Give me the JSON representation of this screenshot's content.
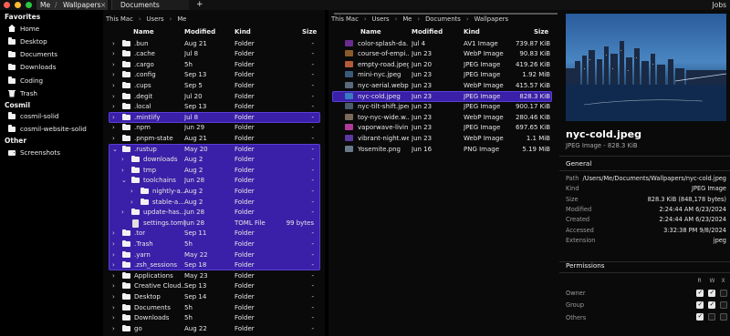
{
  "tabs": {
    "crumb_root": "Me",
    "crumb_sep": "/",
    "active_tab": "Wallpapers",
    "close_glyph": "×",
    "second_tab": "Documents",
    "add_glyph": "+",
    "user": "Jobs"
  },
  "sidebar": {
    "favorites_heading": "Favorites",
    "favorites": [
      {
        "label": "Home",
        "icon": "home-icon"
      },
      {
        "label": "Desktop",
        "icon": "folder-icon"
      },
      {
        "label": "Documents",
        "icon": "folder-icon"
      },
      {
        "label": "Downloads",
        "icon": "folder-icon"
      },
      {
        "label": "Coding",
        "icon": "folder-icon"
      },
      {
        "label": "Trash",
        "icon": "trash-icon"
      }
    ],
    "cosmil_heading": "Cosmil",
    "cosmil": [
      {
        "label": "cosmil-solid",
        "icon": "folder-icon"
      },
      {
        "label": "cosmil-website-solid",
        "icon": "folder-icon"
      }
    ],
    "other_heading": "Other",
    "other": [
      {
        "label": "Screenshots",
        "icon": "drive-icon"
      }
    ]
  },
  "column1": {
    "breadcrumb": [
      "This Mac",
      "Users",
      "Me"
    ],
    "headers": {
      "name": "Name",
      "modified": "Modified",
      "kind": "Kind",
      "size": "Size"
    },
    "rows": [
      {
        "name": ".bun",
        "modified": "Aug 21",
        "kind": "Folder",
        "size": "-",
        "depth": 0,
        "open": false,
        "state": ""
      },
      {
        "name": ".cache",
        "modified": "Jul 8",
        "kind": "Folder",
        "size": "-",
        "depth": 0,
        "open": false,
        "state": ""
      },
      {
        "name": ".cargo",
        "modified": "5h",
        "kind": "Folder",
        "size": "-",
        "depth": 0,
        "open": false,
        "state": ""
      },
      {
        "name": ".config",
        "modified": "Sep 13",
        "kind": "Folder",
        "size": "-",
        "depth": 0,
        "open": false,
        "state": ""
      },
      {
        "name": ".cups",
        "modified": "Sep 5",
        "kind": "Folder",
        "size": "-",
        "depth": 0,
        "open": false,
        "state": ""
      },
      {
        "name": ".degit",
        "modified": "Jul 20",
        "kind": "Folder",
        "size": "-",
        "depth": 0,
        "open": false,
        "state": ""
      },
      {
        "name": ".local",
        "modified": "Sep 13",
        "kind": "Folder",
        "size": "-",
        "depth": 0,
        "open": false,
        "state": ""
      },
      {
        "name": ".mintlify",
        "modified": "Jul 8",
        "kind": "Folder",
        "size": "-",
        "depth": 0,
        "open": false,
        "state": "selected"
      },
      {
        "name": ".npm",
        "modified": "Jun 29",
        "kind": "Folder",
        "size": "-",
        "depth": 0,
        "open": false,
        "state": ""
      },
      {
        "name": ".pnpm-state",
        "modified": "Aug 21",
        "kind": "Folder",
        "size": "-",
        "depth": 0,
        "open": false,
        "state": ""
      },
      {
        "name": ".rustup",
        "modified": "May 20",
        "kind": "Folder",
        "size": "-",
        "depth": 0,
        "open": true,
        "state": "group"
      },
      {
        "name": "downloads",
        "modified": "Aug 2",
        "kind": "Folder",
        "size": "-",
        "depth": 1,
        "open": false,
        "state": "group"
      },
      {
        "name": "tmp",
        "modified": "Aug 2",
        "kind": "Folder",
        "size": "-",
        "depth": 1,
        "open": false,
        "state": "group"
      },
      {
        "name": "toolchains",
        "modified": "Jun 28",
        "kind": "Folder",
        "size": "-",
        "depth": 1,
        "open": true,
        "state": "group"
      },
      {
        "name": "nightly-a...",
        "modified": "Aug 2",
        "kind": "Folder",
        "size": "-",
        "depth": 2,
        "open": false,
        "state": "group"
      },
      {
        "name": "stable-a...",
        "modified": "Aug 2",
        "kind": "Folder",
        "size": "-",
        "depth": 2,
        "open": false,
        "state": "group"
      },
      {
        "name": "update-has...",
        "modified": "Jun 28",
        "kind": "Folder",
        "size": "-",
        "depth": 1,
        "open": false,
        "state": "group"
      },
      {
        "name": "settings.toml",
        "modified": "Jun 28",
        "kind": "TOML File",
        "size": "99 bytes",
        "depth": 1,
        "open": false,
        "state": "group",
        "file": true
      },
      {
        "name": ".tor",
        "modified": "Sep 11",
        "kind": "Folder",
        "size": "-",
        "depth": 0,
        "open": false,
        "state": "group"
      },
      {
        "name": ".Trash",
        "modified": "5h",
        "kind": "Folder",
        "size": "-",
        "depth": 0,
        "open": false,
        "state": "group"
      },
      {
        "name": ".yarn",
        "modified": "May 22",
        "kind": "Folder",
        "size": "-",
        "depth": 0,
        "open": false,
        "state": "group"
      },
      {
        "name": ".zsh_sessions",
        "modified": "Sep 18",
        "kind": "Folder",
        "size": "-",
        "depth": 0,
        "open": false,
        "state": "group"
      },
      {
        "name": "Applications",
        "modified": "May 23",
        "kind": "Folder",
        "size": "-",
        "depth": 0,
        "open": false,
        "state": ""
      },
      {
        "name": "Creative Cloud...",
        "modified": "Sep 13",
        "kind": "Folder",
        "size": "-",
        "depth": 0,
        "open": false,
        "state": ""
      },
      {
        "name": "Desktop",
        "modified": "Sep 14",
        "kind": "Folder",
        "size": "-",
        "depth": 0,
        "open": false,
        "state": ""
      },
      {
        "name": "Documents",
        "modified": "5h",
        "kind": "Folder",
        "size": "-",
        "depth": 0,
        "open": false,
        "state": ""
      },
      {
        "name": "Downloads",
        "modified": "5h",
        "kind": "Folder",
        "size": "-",
        "depth": 0,
        "open": false,
        "state": ""
      },
      {
        "name": "go",
        "modified": "Aug 22",
        "kind": "Folder",
        "size": "-",
        "depth": 0,
        "open": false,
        "state": ""
      }
    ]
  },
  "column2": {
    "breadcrumb": [
      "This Mac",
      "Users",
      "Me",
      "Documents",
      "Wallpapers"
    ],
    "headers": {
      "name": "Name",
      "modified": "Modified",
      "kind": "Kind",
      "size": "Size"
    },
    "rows": [
      {
        "name": "color-splash-da...",
        "modified": "Jul 4",
        "kind": "AV1 Image",
        "size": "739.87 KiB",
        "thumb": "#6a2c8f",
        "state": ""
      },
      {
        "name": "course-of-empi...",
        "modified": "Jun 23",
        "kind": "WebP Image",
        "size": "90.83 KiB",
        "thumb": "#8a5a2a",
        "state": ""
      },
      {
        "name": "empty-road.jpeg",
        "modified": "Jun 20",
        "kind": "JPEG Image",
        "size": "419.26 KiB",
        "thumb": "#b25a3a",
        "state": ""
      },
      {
        "name": "mini-nyc.jpeg",
        "modified": "Jun 23",
        "kind": "JPEG Image",
        "size": "1.92 MiB",
        "thumb": "#3a5a7a",
        "state": ""
      },
      {
        "name": "nyc-aerial.webp",
        "modified": "Jun 23",
        "kind": "WebP Image",
        "size": "415.57 KiB",
        "thumb": "#5a6a7a",
        "state": ""
      },
      {
        "name": "nyc-cold.jpeg",
        "modified": "Jun 23",
        "kind": "JPEG Image",
        "size": "828.3 KiB",
        "thumb": "#3a7ac0",
        "state": "selected"
      },
      {
        "name": "nyc-tilt-shift.jpeg",
        "modified": "Jun 23",
        "kind": "JPEG Image",
        "size": "900.17 KiB",
        "thumb": "#4a5a6a",
        "state": ""
      },
      {
        "name": "toy-nyc-wide.w...",
        "modified": "Jun 23",
        "kind": "WebP Image",
        "size": "280.46 KiB",
        "thumb": "#7a6a5a",
        "state": ""
      },
      {
        "name": "vaporwave-livin...",
        "modified": "Jun 23",
        "kind": "JPEG Image",
        "size": "697.65 KiB",
        "thumb": "#b03a9a",
        "state": ""
      },
      {
        "name": "vibrant-night.we...",
        "modified": "Jun 23",
        "kind": "WebP Image",
        "size": "1.1 MiB",
        "thumb": "#5a3aa0",
        "state": ""
      },
      {
        "name": "Yosemite.png",
        "modified": "Jun 16",
        "kind": "PNG Image",
        "size": "5.19 MiB",
        "thumb": "#6a7a8a",
        "state": ""
      }
    ]
  },
  "preview": {
    "title": "nyc-cold.jpeg",
    "subtitle": "JPEG Image - 828.3 KiB",
    "general_heading": "General",
    "details": [
      {
        "key": "Path",
        "value": "/Users/Me/Documents/Wallpapers/nyc-cold.jpeg"
      },
      {
        "key": "Kind",
        "value": "JPEG Image"
      },
      {
        "key": "Size",
        "value": "828.3 KiB (848,178 bytes)"
      },
      {
        "key": "Modified",
        "value": "2:24:44 AM 6/23/2024"
      },
      {
        "key": "Created",
        "value": "2:24:44 AM 6/23/2024"
      },
      {
        "key": "Accessed",
        "value": "3:32:38 PM 9/8/2024"
      },
      {
        "key": "Extension",
        "value": "jpeg"
      }
    ],
    "permissions_heading": "Permissions",
    "perm_columns": [
      "R",
      "W",
      "X"
    ],
    "permissions": [
      {
        "role": "Owner",
        "r": true,
        "w": true,
        "x": false
      },
      {
        "role": "Group",
        "r": true,
        "w": true,
        "x": false
      },
      {
        "role": "Others",
        "r": true,
        "w": false,
        "x": false
      }
    ]
  },
  "colors": {
    "selection": "#3a20a8",
    "background": "#0a0a0a",
    "sidebar": "#000000"
  }
}
